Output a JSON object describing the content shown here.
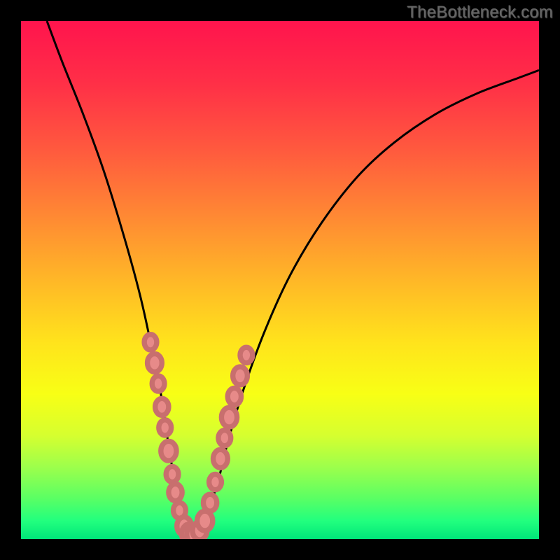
{
  "watermark": {
    "text": "TheBottleneck.com"
  },
  "colors": {
    "black": "#000000",
    "curve": "#000000",
    "marker_fill": "#e78a89",
    "marker_stroke": "#c86f6e",
    "gradient_stops": [
      {
        "offset": 0.0,
        "color": "#ff144d"
      },
      {
        "offset": 0.12,
        "color": "#ff2f47"
      },
      {
        "offset": 0.25,
        "color": "#ff5a3e"
      },
      {
        "offset": 0.38,
        "color": "#ff8a33"
      },
      {
        "offset": 0.5,
        "color": "#ffb727"
      },
      {
        "offset": 0.62,
        "color": "#ffe31c"
      },
      {
        "offset": 0.72,
        "color": "#f8ff15"
      },
      {
        "offset": 0.8,
        "color": "#d6ff2f"
      },
      {
        "offset": 0.86,
        "color": "#9eff4b"
      },
      {
        "offset": 0.92,
        "color": "#5cff63"
      },
      {
        "offset": 0.965,
        "color": "#22ff7e"
      },
      {
        "offset": 1.0,
        "color": "#00e67a"
      }
    ]
  },
  "chart_data": {
    "type": "line",
    "title": "",
    "xlabel": "",
    "ylabel": "",
    "xlim": [
      0,
      100
    ],
    "ylim": [
      0,
      100
    ],
    "grid": false,
    "legend": false,
    "series": [
      {
        "name": "bottleneck-curve",
        "x": [
          5,
          8,
          12,
          16,
          20,
          23,
          25,
          27,
          28.5,
          30,
          31,
          32,
          33,
          34,
          35,
          36,
          38,
          40,
          43,
          47,
          52,
          58,
          65,
          72,
          80,
          88,
          96,
          100
        ],
        "y": [
          100,
          92,
          82,
          71,
          58,
          47,
          38,
          28,
          18,
          9,
          4,
          1.5,
          0.7,
          0.8,
          2,
          5,
          11,
          19,
          29,
          40,
          51,
          61,
          70,
          76.5,
          82,
          86,
          89,
          90.5
        ]
      }
    ],
    "markers": [
      {
        "x": 25.0,
        "y": 38.0,
        "r": 1.2
      },
      {
        "x": 25.8,
        "y": 34.0,
        "r": 1.4
      },
      {
        "x": 26.5,
        "y": 30.0,
        "r": 1.2
      },
      {
        "x": 27.2,
        "y": 25.5,
        "r": 1.3
      },
      {
        "x": 27.8,
        "y": 21.5,
        "r": 1.2
      },
      {
        "x": 28.5,
        "y": 17.0,
        "r": 1.5
      },
      {
        "x": 29.2,
        "y": 12.5,
        "r": 1.2
      },
      {
        "x": 29.8,
        "y": 9.0,
        "r": 1.3
      },
      {
        "x": 30.6,
        "y": 5.5,
        "r": 1.2
      },
      {
        "x": 31.5,
        "y": 2.5,
        "r": 1.4
      },
      {
        "x": 32.5,
        "y": 1.0,
        "r": 1.5
      },
      {
        "x": 33.5,
        "y": 0.9,
        "r": 1.5
      },
      {
        "x": 34.5,
        "y": 1.6,
        "r": 1.4
      },
      {
        "x": 35.5,
        "y": 3.5,
        "r": 1.5
      },
      {
        "x": 36.5,
        "y": 7.0,
        "r": 1.3
      },
      {
        "x": 37.5,
        "y": 11.0,
        "r": 1.2
      },
      {
        "x": 38.5,
        "y": 15.5,
        "r": 1.4
      },
      {
        "x": 39.3,
        "y": 19.5,
        "r": 1.2
      },
      {
        "x": 40.2,
        "y": 23.5,
        "r": 1.5
      },
      {
        "x": 41.2,
        "y": 27.5,
        "r": 1.3
      },
      {
        "x": 42.3,
        "y": 31.5,
        "r": 1.4
      },
      {
        "x": 43.5,
        "y": 35.5,
        "r": 1.2
      }
    ]
  }
}
